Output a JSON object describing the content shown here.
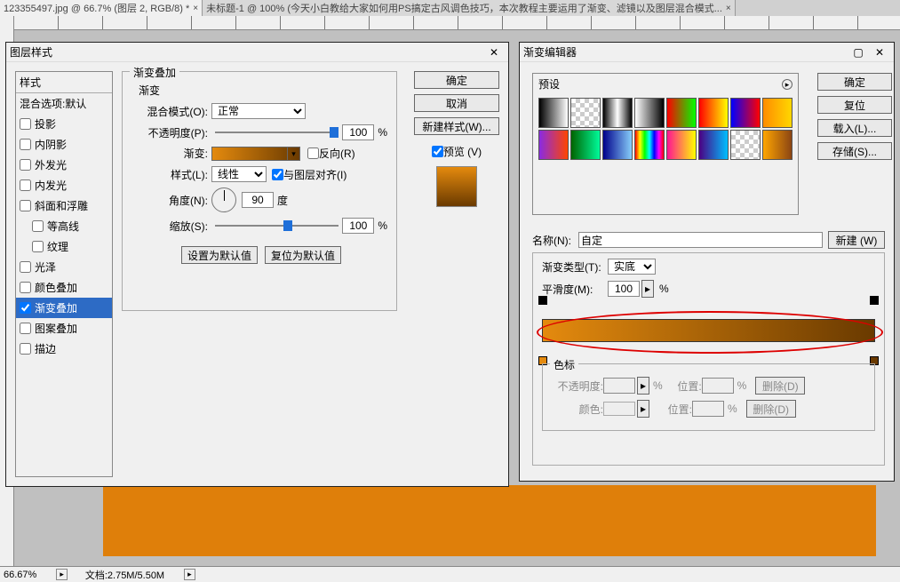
{
  "tabs": [
    {
      "label": "123355497.jpg @ 66.7% (图层 2, RGB/8) *"
    },
    {
      "label": "未标题-1 @ 100% (今天小白教给大家如何用PS搞定古风调色技巧，本次教程主要运用了渐变、滤镜以及图层混合模式..."
    }
  ],
  "layerStyle": {
    "title": "图层样式",
    "styles_header": "样式",
    "blend_header": "混合选项:默认",
    "items": [
      {
        "label": "投影",
        "checked": false
      },
      {
        "label": "内阴影",
        "checked": false
      },
      {
        "label": "外发光",
        "checked": false
      },
      {
        "label": "内发光",
        "checked": false
      },
      {
        "label": "斜面和浮雕",
        "checked": false
      },
      {
        "label": "等高线",
        "checked": false,
        "indent": true
      },
      {
        "label": "纹理",
        "checked": false,
        "indent": true
      },
      {
        "label": "光泽",
        "checked": false
      },
      {
        "label": "颜色叠加",
        "checked": false
      },
      {
        "label": "渐变叠加",
        "checked": true,
        "selected": true
      },
      {
        "label": "图案叠加",
        "checked": false
      },
      {
        "label": "描边",
        "checked": false
      }
    ],
    "group_title": "渐变叠加",
    "group_sub": "渐变",
    "blendmode_label": "混合模式(O):",
    "blendmode_value": "正常",
    "opacity_label": "不透明度(P):",
    "opacity_value": "100",
    "pct": "%",
    "gradient_label": "渐变:",
    "reverse_label": "反向(R)",
    "style_label": "样式(L):",
    "style_value": "线性",
    "align_label": "与图层对齐(I)",
    "angle_label": "角度(N):",
    "angle_value": "90",
    "degree": "度",
    "scale_label": "缩放(S):",
    "scale_value": "100",
    "set_default": "设置为默认值",
    "reset_default": "复位为默认值",
    "ok": "确定",
    "cancel": "取消",
    "newstyle": "新建样式(W)...",
    "preview": "预览 (V)"
  },
  "gradEditor": {
    "title": "渐变编辑器",
    "presets_label": "预设",
    "name_label": "名称(N):",
    "name_value": "自定",
    "new_btn": "新建 (W)",
    "type_label": "渐变类型(T):",
    "type_value": "实底",
    "smooth_label": "平滑度(M):",
    "smooth_value": "100",
    "pct": "%",
    "stops_label": "色标",
    "stop_opacity_label": "不透明度:",
    "stop_location_label": "位置:",
    "stop_color_label": "颜色:",
    "delete": "删除(D)",
    "ok": "确定",
    "reset": "复位",
    "load": "载入(L)...",
    "save": "存储(S)..."
  },
  "status": {
    "zoom": "66.67%",
    "doc": "文档:2.75M/5.50M"
  }
}
